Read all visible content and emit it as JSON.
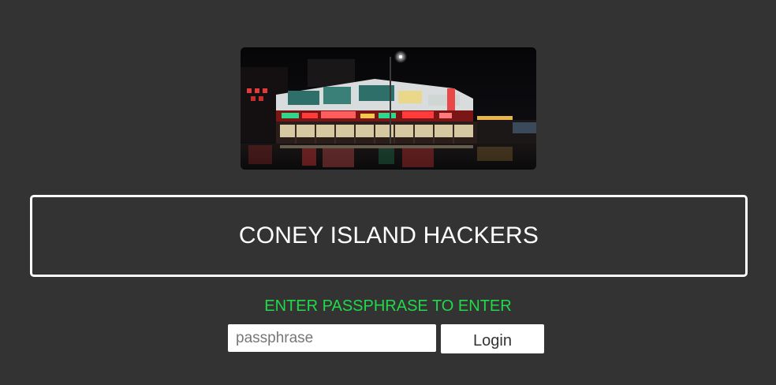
{
  "hero": {
    "image_name": "coney-island-storefront-night"
  },
  "title": "CONEY ISLAND HACKERS",
  "prompt": "ENTER PASSPHRASE TO ENTER",
  "form": {
    "passphrase_value": "",
    "passphrase_placeholder": "passphrase",
    "login_label": "Login"
  },
  "colors": {
    "background": "#333333",
    "prompt": "#22d94a",
    "border": "#ffffff"
  }
}
